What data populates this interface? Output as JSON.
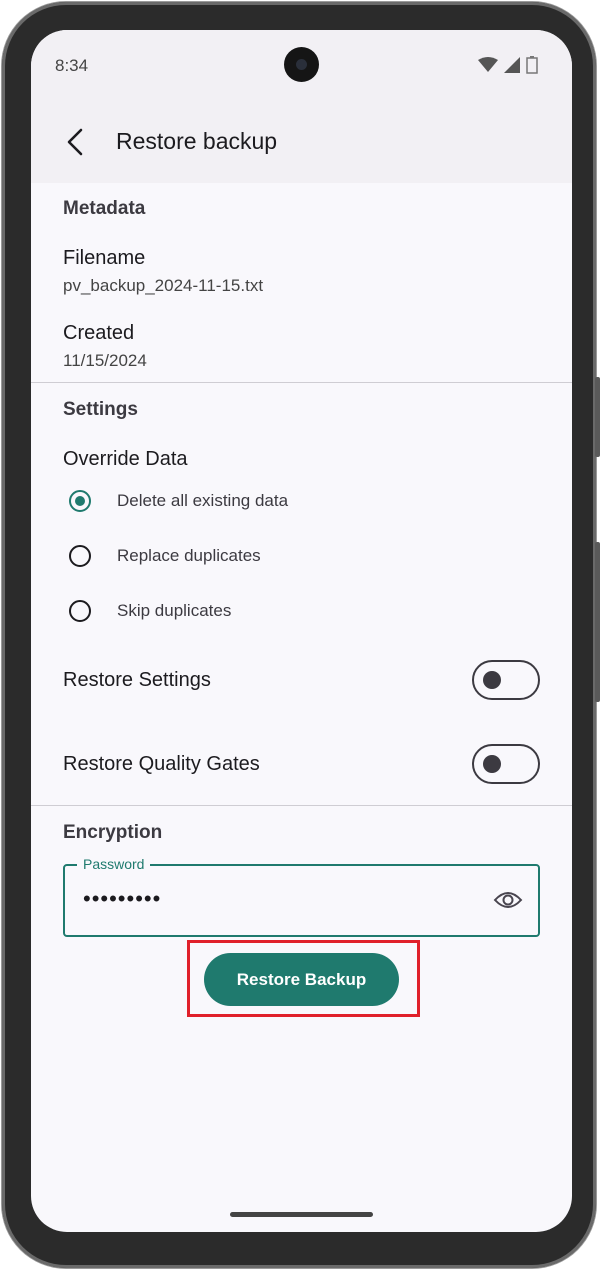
{
  "status_bar": {
    "time": "8:34"
  },
  "app_bar": {
    "title": "Restore backup"
  },
  "metadata": {
    "section_title": "Metadata",
    "filename_label": "Filename",
    "filename_value": "pv_backup_2024-11-15.txt",
    "created_label": "Created",
    "created_value": "11/15/2024"
  },
  "settings": {
    "section_title": "Settings",
    "override_label": "Override Data",
    "options": [
      {
        "label": "Delete all existing data",
        "selected": true
      },
      {
        "label": "Replace duplicates",
        "selected": false
      },
      {
        "label": "Skip duplicates",
        "selected": false
      }
    ],
    "restore_settings_label": "Restore Settings",
    "restore_settings_on": false,
    "restore_quality_gates_label": "Restore Quality Gates",
    "restore_quality_gates_on": false
  },
  "encryption": {
    "section_title": "Encryption",
    "password_label": "Password",
    "password_value": "•••••••••"
  },
  "actions": {
    "restore_button": "Restore Backup"
  },
  "colors": {
    "accent": "#1f7a6e",
    "highlight_border": "#e0202a"
  }
}
